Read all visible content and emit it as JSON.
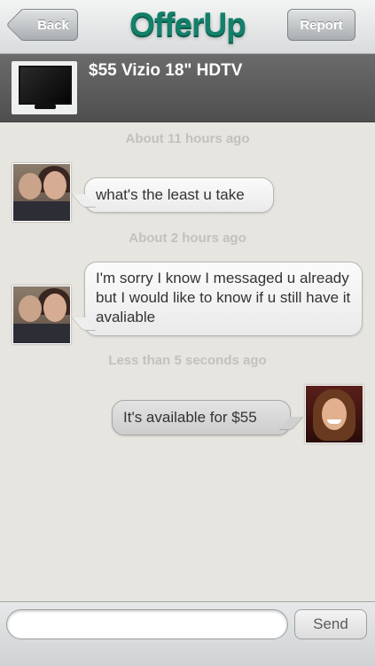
{
  "navbar": {
    "back_label": "Back",
    "logo_text": "OfferUp",
    "report_label": "Report"
  },
  "item": {
    "title": "$55 Vizio 18\" HDTV",
    "thumbnail_icon": "tv-thumbnail"
  },
  "messages": [
    {
      "timestamp": "About 11 hours ago",
      "text": "what's the least u take",
      "direction": "incoming"
    },
    {
      "timestamp": "About 2 hours ago",
      "text": "I'm sorry I know I messaged u already but I would like to know if u still have it avaliable",
      "direction": "incoming"
    },
    {
      "timestamp": "Less than 5 seconds ago",
      "text": "It's available for $55",
      "direction": "outgoing"
    }
  ],
  "composer": {
    "placeholder": "",
    "send_label": "Send"
  },
  "colors": {
    "brand": "#13806a",
    "item_bar": "#5b5b5b",
    "chat_background": "#e7e5e0"
  }
}
